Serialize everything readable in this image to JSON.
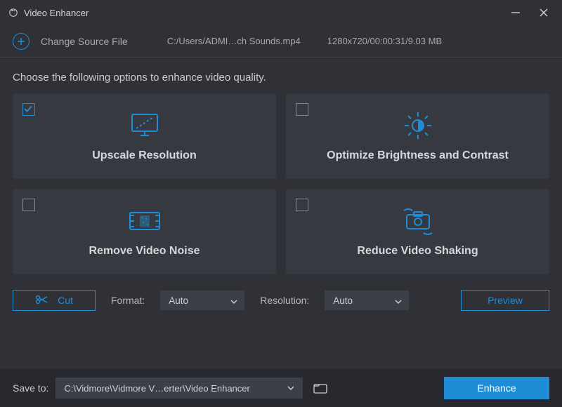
{
  "window": {
    "title": "Video Enhancer"
  },
  "filebar": {
    "change_label": "Change Source File",
    "path": "C:/Users/ADMI…ch Sounds.mp4",
    "meta": "1280x720/00:00:31/9.03 MB"
  },
  "prompt": "Choose the following options to enhance video quality.",
  "cards": {
    "upscale": {
      "label": "Upscale Resolution",
      "checked": true
    },
    "bright": {
      "label": "Optimize Brightness and Contrast",
      "checked": false
    },
    "denoise": {
      "label": "Remove Video Noise",
      "checked": false
    },
    "deshake": {
      "label": "Reduce Video Shaking",
      "checked": false
    }
  },
  "controls": {
    "cut_label": "Cut",
    "format_label": "Format:",
    "format_value": "Auto",
    "resolution_label": "Resolution:",
    "resolution_value": "Auto",
    "preview_label": "Preview"
  },
  "footer": {
    "save_label": "Save to:",
    "save_path": "C:\\Vidmore\\Vidmore V…erter\\Video Enhancer",
    "enhance_label": "Enhance"
  }
}
